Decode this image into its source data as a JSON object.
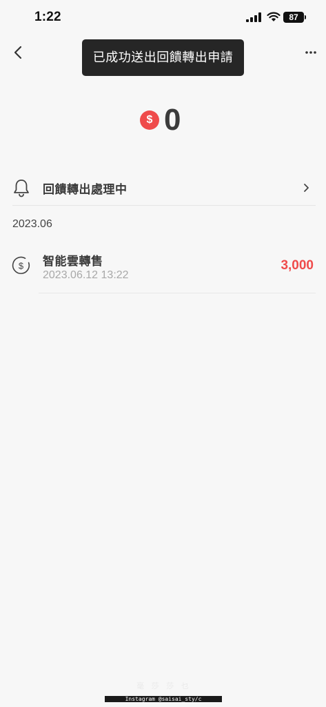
{
  "status_bar": {
    "time": "1:22",
    "battery": "87"
  },
  "toast": {
    "message": "已成功送出回饋轉出申請"
  },
  "balance": {
    "currency_symbol": "$",
    "value": "0"
  },
  "pending": {
    "label": "回饋轉出處理中"
  },
  "month_header": "2023.06",
  "transactions": [
    {
      "title": "智能雲轉售",
      "date": "2023.06.12 13:22",
      "amount": "3,000"
    }
  ],
  "watermark": {
    "top_text": "毫 莎 莎 乜",
    "bottom_text": "Instagram @saisai_sty/c"
  },
  "colors": {
    "accent": "#ef4b4b",
    "background": "#f7f7f7",
    "toast_bg": "#262626"
  },
  "icons": {
    "back": "chevron-left-icon",
    "more": "more-horizontal-icon",
    "coin": "dollar-coin-icon",
    "bell": "bell-icon",
    "chevron": "chevron-right-icon",
    "txn": "dollar-circle-icon"
  }
}
